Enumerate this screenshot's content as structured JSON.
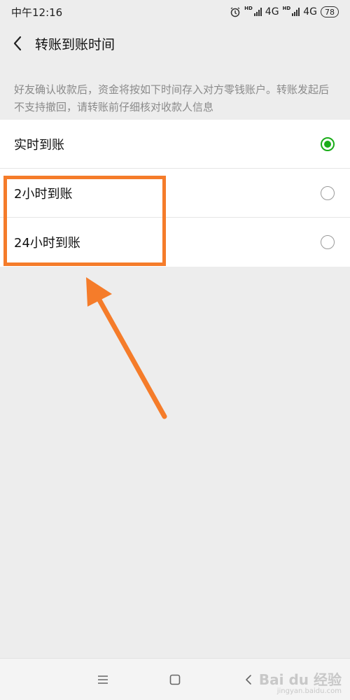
{
  "status_bar": {
    "time": "中午12:16",
    "hd1": "HD",
    "network1": "4G",
    "hd2": "HD",
    "network2": "4G",
    "battery": "78",
    "icons": [
      "alarm-icon",
      "signal-icon",
      "signal-icon",
      "battery-icon"
    ]
  },
  "header": {
    "back_icon": "chevron-left-icon",
    "title": "转账到账时间"
  },
  "notice": "好友确认收款后，资金将按如下时间存入对方零钱账户。转账发起后不支持撤回，请转账前仔细核对收款人信息",
  "options": [
    {
      "label": "实时到账",
      "selected": true
    },
    {
      "label": "2小时到账",
      "selected": false
    },
    {
      "label": "24小时到账",
      "selected": false
    }
  ],
  "colors": {
    "accent": "#1aad19",
    "highlight": "#f57c2a",
    "background": "#ededed"
  },
  "nav_bar": {
    "icons": [
      "menu-icon",
      "home-square-icon",
      "back-icon"
    ]
  },
  "watermark": {
    "main": "Bai du 经验",
    "sub": "jingyan.baidu.com"
  }
}
